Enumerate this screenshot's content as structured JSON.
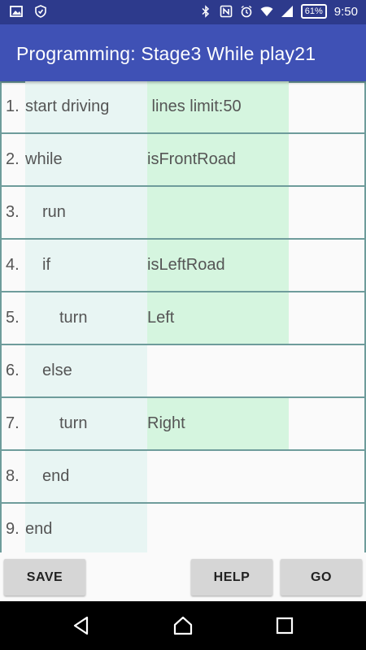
{
  "status": {
    "battery": "61%",
    "time": "9:50"
  },
  "app": {
    "title": "Programming: Stage3 While play21"
  },
  "program": {
    "rows": [
      {
        "num": "1.",
        "cmd": "start driving",
        "arg": " lines limit:50",
        "indent": 0,
        "arg_bg": true
      },
      {
        "num": "2.",
        "cmd": "while",
        "arg": "isFrontRoad",
        "indent": 0,
        "arg_bg": true
      },
      {
        "num": "3.",
        "cmd": "run",
        "arg": "",
        "indent": 1,
        "arg_bg": true
      },
      {
        "num": "4.",
        "cmd": "if",
        "arg": "isLeftRoad",
        "indent": 1,
        "arg_bg": true
      },
      {
        "num": "5.",
        "cmd": "turn",
        "arg": "Left",
        "indent": 2,
        "arg_bg": true
      },
      {
        "num": "6.",
        "cmd": "else",
        "arg": "",
        "indent": 1,
        "arg_bg": false
      },
      {
        "num": "7.",
        "cmd": "turn",
        "arg": "Right",
        "indent": 2,
        "arg_bg": true
      },
      {
        "num": "8.",
        "cmd": "end",
        "arg": "",
        "indent": 1,
        "arg_bg": false
      },
      {
        "num": "9.",
        "cmd": "end",
        "arg": "",
        "indent": 0,
        "arg_bg": false
      }
    ]
  },
  "buttons": {
    "save": "SAVE",
    "help": "HELP",
    "go": "GO"
  },
  "icons": {
    "status_left": [
      "image-icon",
      "shield-icon"
    ],
    "status_right": [
      "bluetooth-icon",
      "nfc-icon",
      "alarm-icon",
      "wifi-icon",
      "signal-icon"
    ],
    "nav": [
      "back-icon",
      "home-icon",
      "recents-icon"
    ]
  },
  "colors": {
    "appbar": "#3f51b5",
    "statusbar": "#2d3a8c",
    "cmd_bg": "#e8f5f3",
    "arg_bg": "#d5f5df",
    "divider": "#6e9c9b"
  }
}
